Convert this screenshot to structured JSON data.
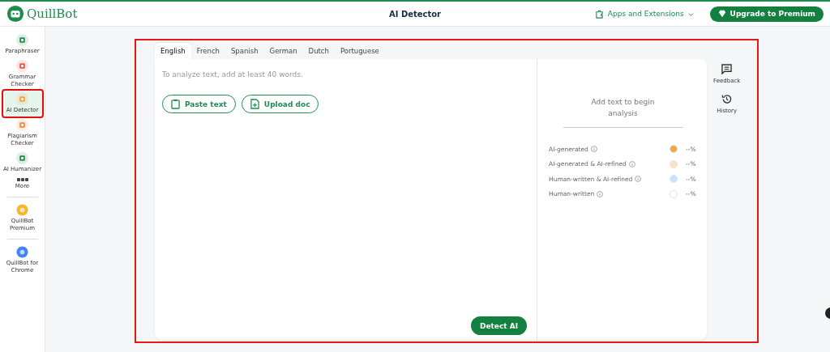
{
  "header": {
    "logo": "QuillBot",
    "title": "AI Detector",
    "apps_menu": "Apps and Extensions",
    "upgrade_button": "Upgrade to Premium"
  },
  "sidebar": {
    "items": [
      {
        "label": "Paraphraser",
        "kind": "tool",
        "selected": false,
        "color": "#1f8c4f"
      },
      {
        "label": "Grammar Checker",
        "kind": "tool",
        "selected": false,
        "color": "#e2574c"
      },
      {
        "label": "AI Detector",
        "kind": "tool",
        "selected": true,
        "color": "#f0a23b"
      },
      {
        "label": "Plagiarism Checker",
        "kind": "tool",
        "selected": false,
        "color": "#f08a3b"
      },
      {
        "label": "AI Humanizer",
        "kind": "tool",
        "selected": false,
        "color": "#1f8c4f"
      },
      {
        "label": "More",
        "kind": "more",
        "selected": false,
        "color": "#444444"
      },
      {
        "label": "QuillBot Premium",
        "kind": "promo",
        "selected": false,
        "color": "#f5b82e"
      },
      {
        "label": "QuillBot for Chrome",
        "kind": "promo",
        "selected": false,
        "color": "#4285f4"
      }
    ]
  },
  "languages": [
    {
      "label": "English",
      "selected": true
    },
    {
      "label": "French",
      "selected": false
    },
    {
      "label": "Spanish",
      "selected": false
    },
    {
      "label": "German",
      "selected": false
    },
    {
      "label": "Dutch",
      "selected": false
    },
    {
      "label": "Portuguese",
      "selected": false
    }
  ],
  "editor": {
    "placeholder": "To analyze text, add at least 40 words.",
    "paste_button": "Paste text",
    "upload_button": "Upload doc",
    "detect_button": "Detect AI"
  },
  "results": {
    "message": "Add text to begin analysis",
    "legend": [
      {
        "label": "AI-generated",
        "color": "#f5a742",
        "value": "--%"
      },
      {
        "label": "AI-generated & AI-refined",
        "color": "#fae3c4",
        "value": "--%"
      },
      {
        "label": "Human-written & AI-refined",
        "color": "#cfe0f8",
        "value": "--%"
      },
      {
        "label": "Human-written",
        "color": "#ffffff",
        "value": "--%"
      }
    ]
  },
  "tools": [
    {
      "label": "Feedback",
      "kind": "feedback"
    },
    {
      "label": "History",
      "kind": "history"
    }
  ]
}
